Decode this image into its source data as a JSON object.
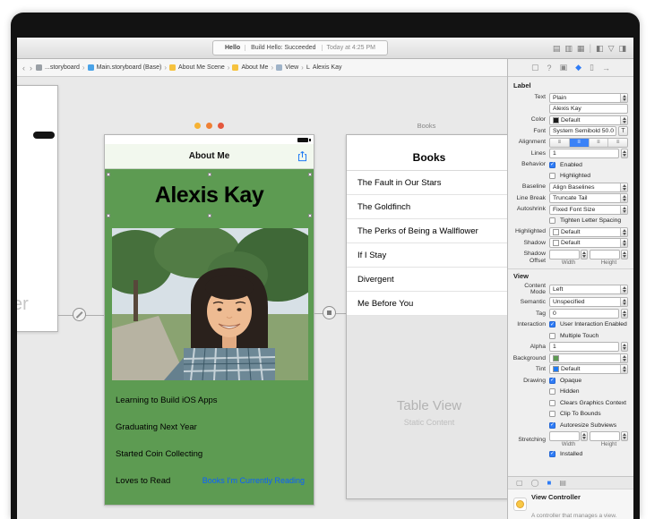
{
  "toolbar": {
    "project": "Hello",
    "status": "Build Hello: Succeeded",
    "time": "Today at 4:25 PM"
  },
  "jumpbar": {
    "crumbs": [
      "...storyboard",
      "Main.storyboard (Base)",
      "About Me Scene",
      "About Me",
      "View",
      "Alexis Kay"
    ],
    "label_icon": "L"
  },
  "canvas": {
    "left_scene": {
      "clipped_text": "er"
    },
    "about_me": {
      "nav_title": "About Me",
      "name": "Alexis Kay",
      "rows": [
        "Learning to Build iOS Apps",
        "Graduating Next Year",
        "Started Coin Collecting",
        "Loves to Read"
      ],
      "link": "Books I'm Currently Reading"
    },
    "books": {
      "scene_title": "Books",
      "header": "Books",
      "cells": [
        "The Fault in Our Stars",
        "The Goldfinch",
        "The Perks of Being a Wallflower",
        "If I Stay",
        "Divergent",
        "Me Before You"
      ],
      "placeholder_title": "Table View",
      "placeholder_sub": "Static Content"
    }
  },
  "inspector": {
    "section_label": "Label",
    "text_label": "Text",
    "text_style": "Plain",
    "text_value": "Alexis Kay",
    "color_label": "Color",
    "color_value": "Default",
    "font_label": "Font",
    "font_value": "System Semibold 50.0",
    "font_button": "T",
    "alignment_label": "Alignment",
    "lines_label": "Lines",
    "lines_value": "1",
    "behavior_label": "Behavior",
    "behavior_enabled": "Enabled",
    "behavior_highlighted": "Highlighted",
    "baseline_label": "Baseline",
    "baseline_value": "Align Baselines",
    "linebreak_label": "Line Break",
    "linebreak_value": "Truncate Tail",
    "autoshrink_label": "Autoshrink",
    "autoshrink_value": "Fixed Font Size",
    "tighten_label": "Tighten Letter Spacing",
    "highlighted_label": "Highlighted",
    "highlighted_value": "Default",
    "shadow_label": "Shadow",
    "shadow_value": "Default",
    "shadow_offset_label": "Shadow Offset",
    "width_label": "Width",
    "height_label": "Height",
    "section_view": "View",
    "content_mode_label": "Content Mode",
    "content_mode_value": "Left",
    "semantic_label": "Semantic",
    "semantic_value": "Unspecified",
    "tag_label": "Tag",
    "tag_value": "0",
    "interaction_label": "Interaction",
    "interaction_uie": "User Interaction Enabled",
    "interaction_mt": "Multiple Touch",
    "alpha_label": "Alpha",
    "alpha_value": "1",
    "background_label": "Background",
    "background_value": "",
    "tint_label": "Tint",
    "tint_value": "Default",
    "drawing_label": "Drawing",
    "drawing_opts": [
      "Opaque",
      "Hidden",
      "Clears Graphics Context",
      "Clip To Bounds",
      "Autoresize Subviews"
    ],
    "stretching_label": "Stretching",
    "installed_label": "Installed",
    "library_item_title": "View Controller",
    "library_item_desc": "A controller that manages a view."
  },
  "colors": {
    "accent_blue": "#2f7cf6",
    "view_green": "#5d9b52",
    "link_blue": "#0a60ff",
    "dock_dot_1": "#f6b233",
    "dock_dot_2": "#ef8034",
    "dock_dot_3": "#e4573d"
  }
}
